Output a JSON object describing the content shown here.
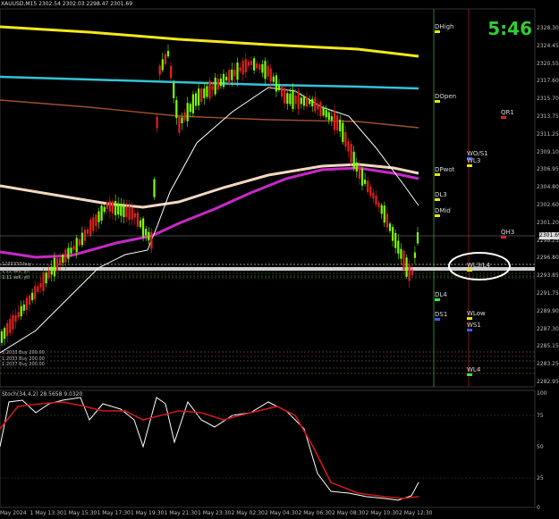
{
  "header": {
    "symbol": "XAUUSD,M15",
    "ohlc": "2302.54 2302.03 2298.47 2301.69"
  },
  "timer": "5:46",
  "price_axis": [
    "2328.30",
    "2324.45",
    "2320.55",
    "2317.60",
    "2315.70",
    "2313.75",
    "2311.25",
    "2309.10",
    "2306.95",
    "2304.80",
    "2302.60",
    "2301.20",
    "2298.25",
    "2296.80",
    "2293.85",
    "2291.75",
    "2289.90",
    "2287.30",
    "2285.15",
    "2283.25",
    "2282.95"
  ],
  "current_price": "2301.69",
  "time_axis": [
    "May 2024",
    "1 May 13:30",
    "1 May 15:30",
    "1 May 17:30",
    "1 May 19:30",
    "1 May 21:30",
    "1 May 23:30",
    "2 May 02:30",
    "2 May 04:30",
    "2 May 06:30",
    "2 May 08:30",
    "2 May 10:30",
    "2 May 12:30"
  ],
  "level_labels": [
    "DHigh",
    "DOpen",
    "QR1",
    "DPwot",
    "WO/S1",
    "WL3",
    "DL3",
    "DMid",
    "QH3",
    "WL3/L4",
    "DL4",
    "DS1",
    "WLow",
    "WS1",
    "WL4"
  ],
  "indicator": {
    "label": "Stoch(34,4,2) 28.5658 9.0320",
    "axis": [
      "100",
      "75",
      "50",
      "25",
      "0"
    ]
  },
  "left_labels": [
    "1233333 buy",
    "1:22 sell, ytl",
    "1:11 sell, ytl",
    "1:2033 Buy 200.00",
    "1:2033 Buy 200.00",
    "1:2037 Buy 200.00"
  ],
  "colors": {
    "bull": "#7cfc00",
    "bear": "#e02020",
    "yellow_ma": "#f4e81c",
    "cyan_ma": "#32c4d8",
    "magenta_ma": "#c828c8",
    "cream_ma": "#f2d8c0",
    "brown_ma": "#a0502a",
    "stoch_main": "#ffffff",
    "stoch_signal": "#d01818"
  }
}
